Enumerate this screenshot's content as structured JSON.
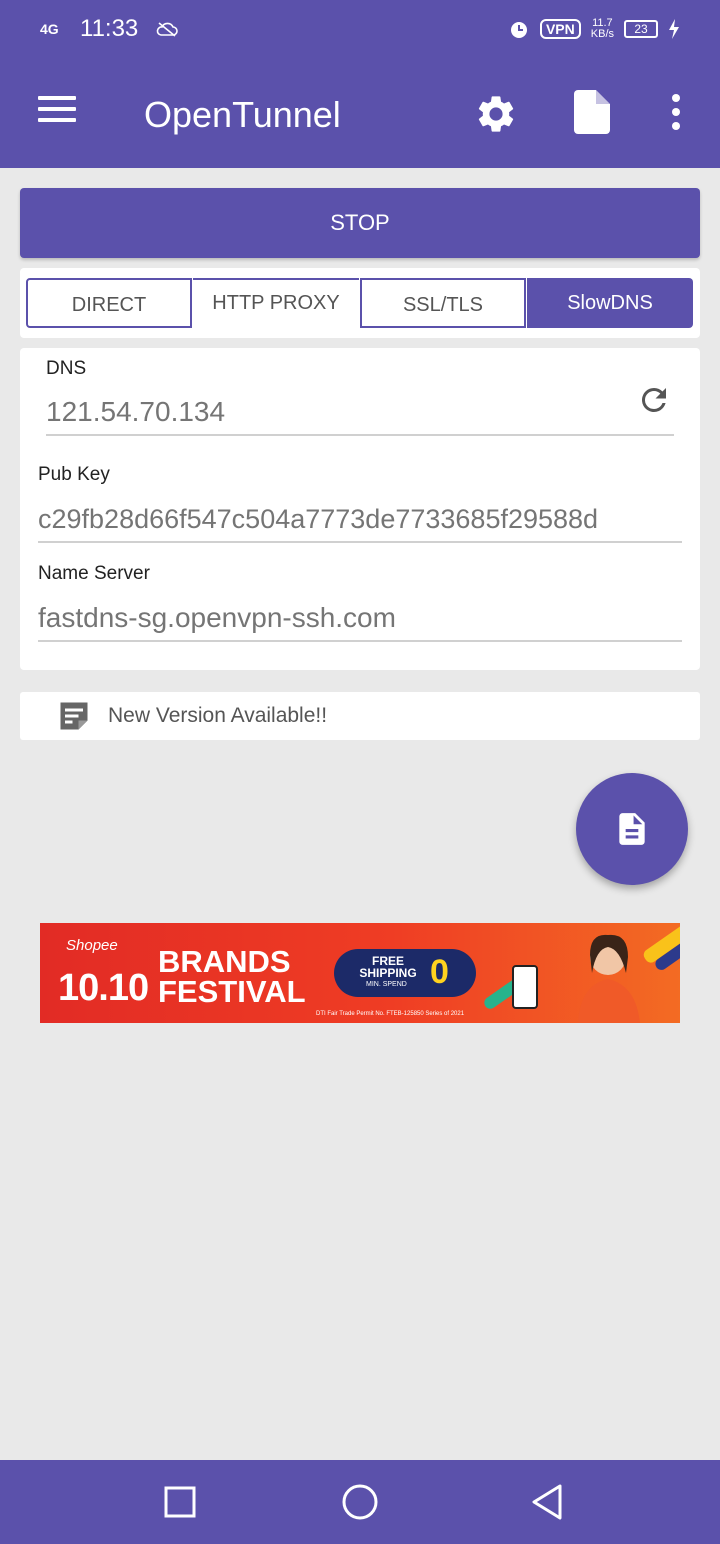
{
  "status_bar": {
    "network": "4G",
    "time": "11:33",
    "vpn": "VPN",
    "speed_value": "11.7",
    "speed_unit": "KB/s",
    "battery": "23"
  },
  "app_bar": {
    "title": "OpenTunnel"
  },
  "stop_button": "STOP",
  "tabs": [
    {
      "label": "DIRECT",
      "selected": false
    },
    {
      "label": "HTTP PROXY",
      "selected": false
    },
    {
      "label": "SSL/TLS",
      "selected": false
    },
    {
      "label": "SlowDNS",
      "selected": true
    }
  ],
  "form": {
    "dns": {
      "label": "DNS",
      "placeholder": "121.54.70.134"
    },
    "pub_key": {
      "label": "Pub Key",
      "placeholder": "c29fb28d66f547c504a7773de7733685f29588d"
    },
    "name_server": {
      "label": "Name Server",
      "placeholder": "fastdns-sg.openvpn-ssh.com"
    }
  },
  "notice": "New Version Available!!",
  "ad": {
    "brand": "Shopee",
    "date": "10.10",
    "headline_1": "BRANDS",
    "headline_2": "FESTIVAL",
    "free_1": "FREE",
    "free_2": "SHIPPING",
    "zero": "0",
    "min_spend": "MIN. SPEND",
    "fine_print": "DTI Fair Trade Permit No. FTEB-125850 Series of 2021"
  },
  "colors": {
    "primary": "#5b51ab",
    "background": "#e9e9e9",
    "card": "#ffffff",
    "placeholder": "#c4c4c4"
  }
}
